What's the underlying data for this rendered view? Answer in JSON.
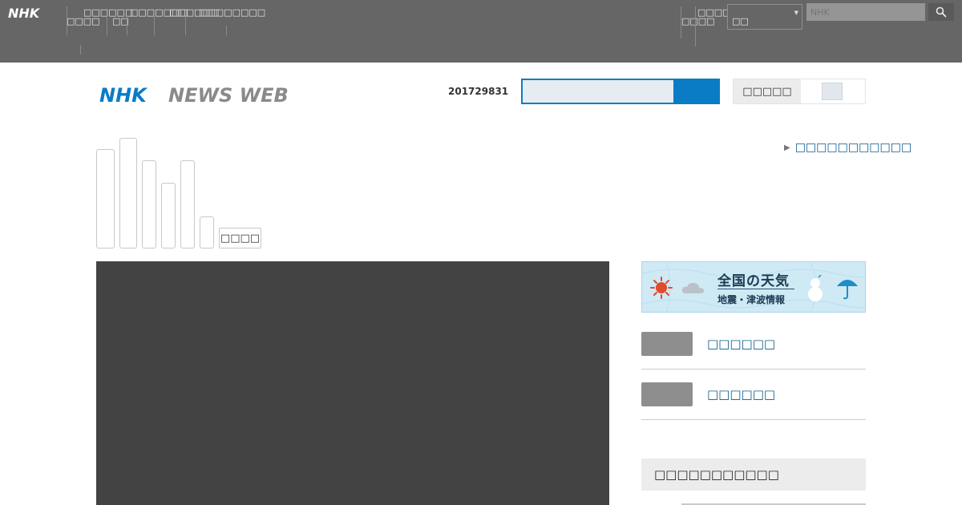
{
  "global_bar": {
    "logo": "NHK",
    "nav_left": [
      "□□□□",
      "□□□□□□",
      "□□",
      "□□□□□□□",
      "□□□□□□",
      "□□□□□□□□"
    ],
    "nav_right": [
      "□□□□",
      "□□□□□"
    ],
    "region": "□□",
    "search_placeholder": "NHK"
  },
  "header": {
    "logo_nhk": "NHK",
    "logo_news_web": "NEWS WEB",
    "counter": "201729831",
    "search_value": "",
    "font_size_label": "□□□□□"
  },
  "toolbar": {
    "button_label": "□□□□",
    "right_link": "□□□□□□□□□□□"
  },
  "sidebar": {
    "weather_title": "全国の天気",
    "weather_sub": "地震・津波情報",
    "items": [
      {
        "label": "□□□□□□"
      },
      {
        "label": "□□□□□□"
      }
    ],
    "ranking_title": "□□□□□□□□□□□"
  },
  "colors": {
    "global_bar": "#666666",
    "brand_blue": "#0a7cc6",
    "link_blue": "#0b5a8a",
    "main_panel": "#434343"
  }
}
